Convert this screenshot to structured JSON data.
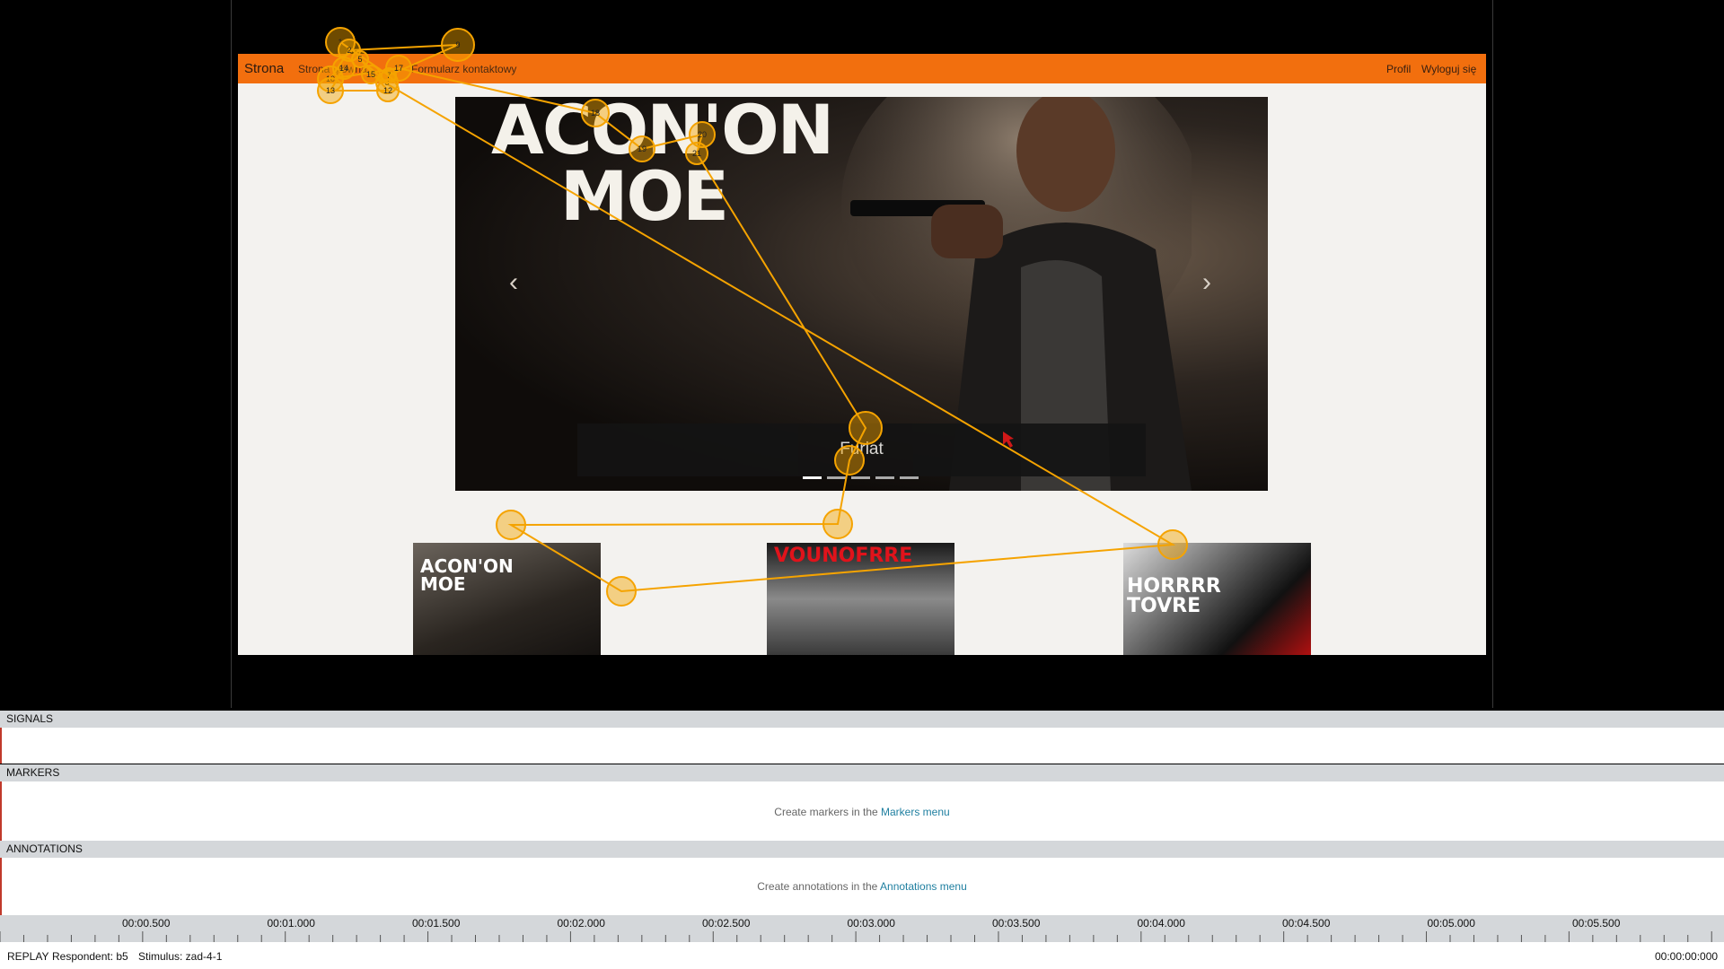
{
  "navbar": {
    "brand": "Strona",
    "links": [
      "Strona główna",
      "Formularz kontaktowy"
    ],
    "right": [
      "Profil",
      "Wyloguj się"
    ]
  },
  "carousel": {
    "slide_title": "ACON'ON MOE",
    "caption": "Furiat",
    "prev_icon": "chevron-left-icon",
    "next_icon": "chevron-right-icon",
    "indicator_count": 5,
    "active_indicator": 1
  },
  "thumbnails": [
    {
      "title": "ACON'ON MOE"
    },
    {
      "title": "VOUNOFRRE"
    },
    {
      "title": "HORRRR TOVRE"
    }
  ],
  "gaze": {
    "fixation_labels": [
      "1",
      "2",
      "3",
      "5",
      "7",
      "9",
      "10",
      "12",
      "13",
      "14",
      "15",
      "17",
      "18",
      "19",
      "20",
      "21"
    ],
    "color": "#f5a300"
  },
  "panels": {
    "signals": "SIGNALS",
    "markers": "MARKERS",
    "markers_msg_prefix": "Create markers in the ",
    "markers_link": "Markers menu",
    "annotations": "ANNOTATIONS",
    "annotations_msg_prefix": "Create annotations in the ",
    "annotations_link": "Annotations menu"
  },
  "timeline": {
    "ticks": [
      "00:00.500",
      "00:01.000",
      "00:01.500",
      "00:02.000",
      "00:02.500",
      "00:03.000",
      "00:03.500",
      "00:04.000",
      "00:04.500",
      "00:05.000",
      "00:05.500"
    ]
  },
  "status": {
    "mode": "REPLAY",
    "respondent": "Respondent: b5",
    "stimulus": "Stimulus: zad-4-1",
    "time": "00:00:00:000"
  }
}
